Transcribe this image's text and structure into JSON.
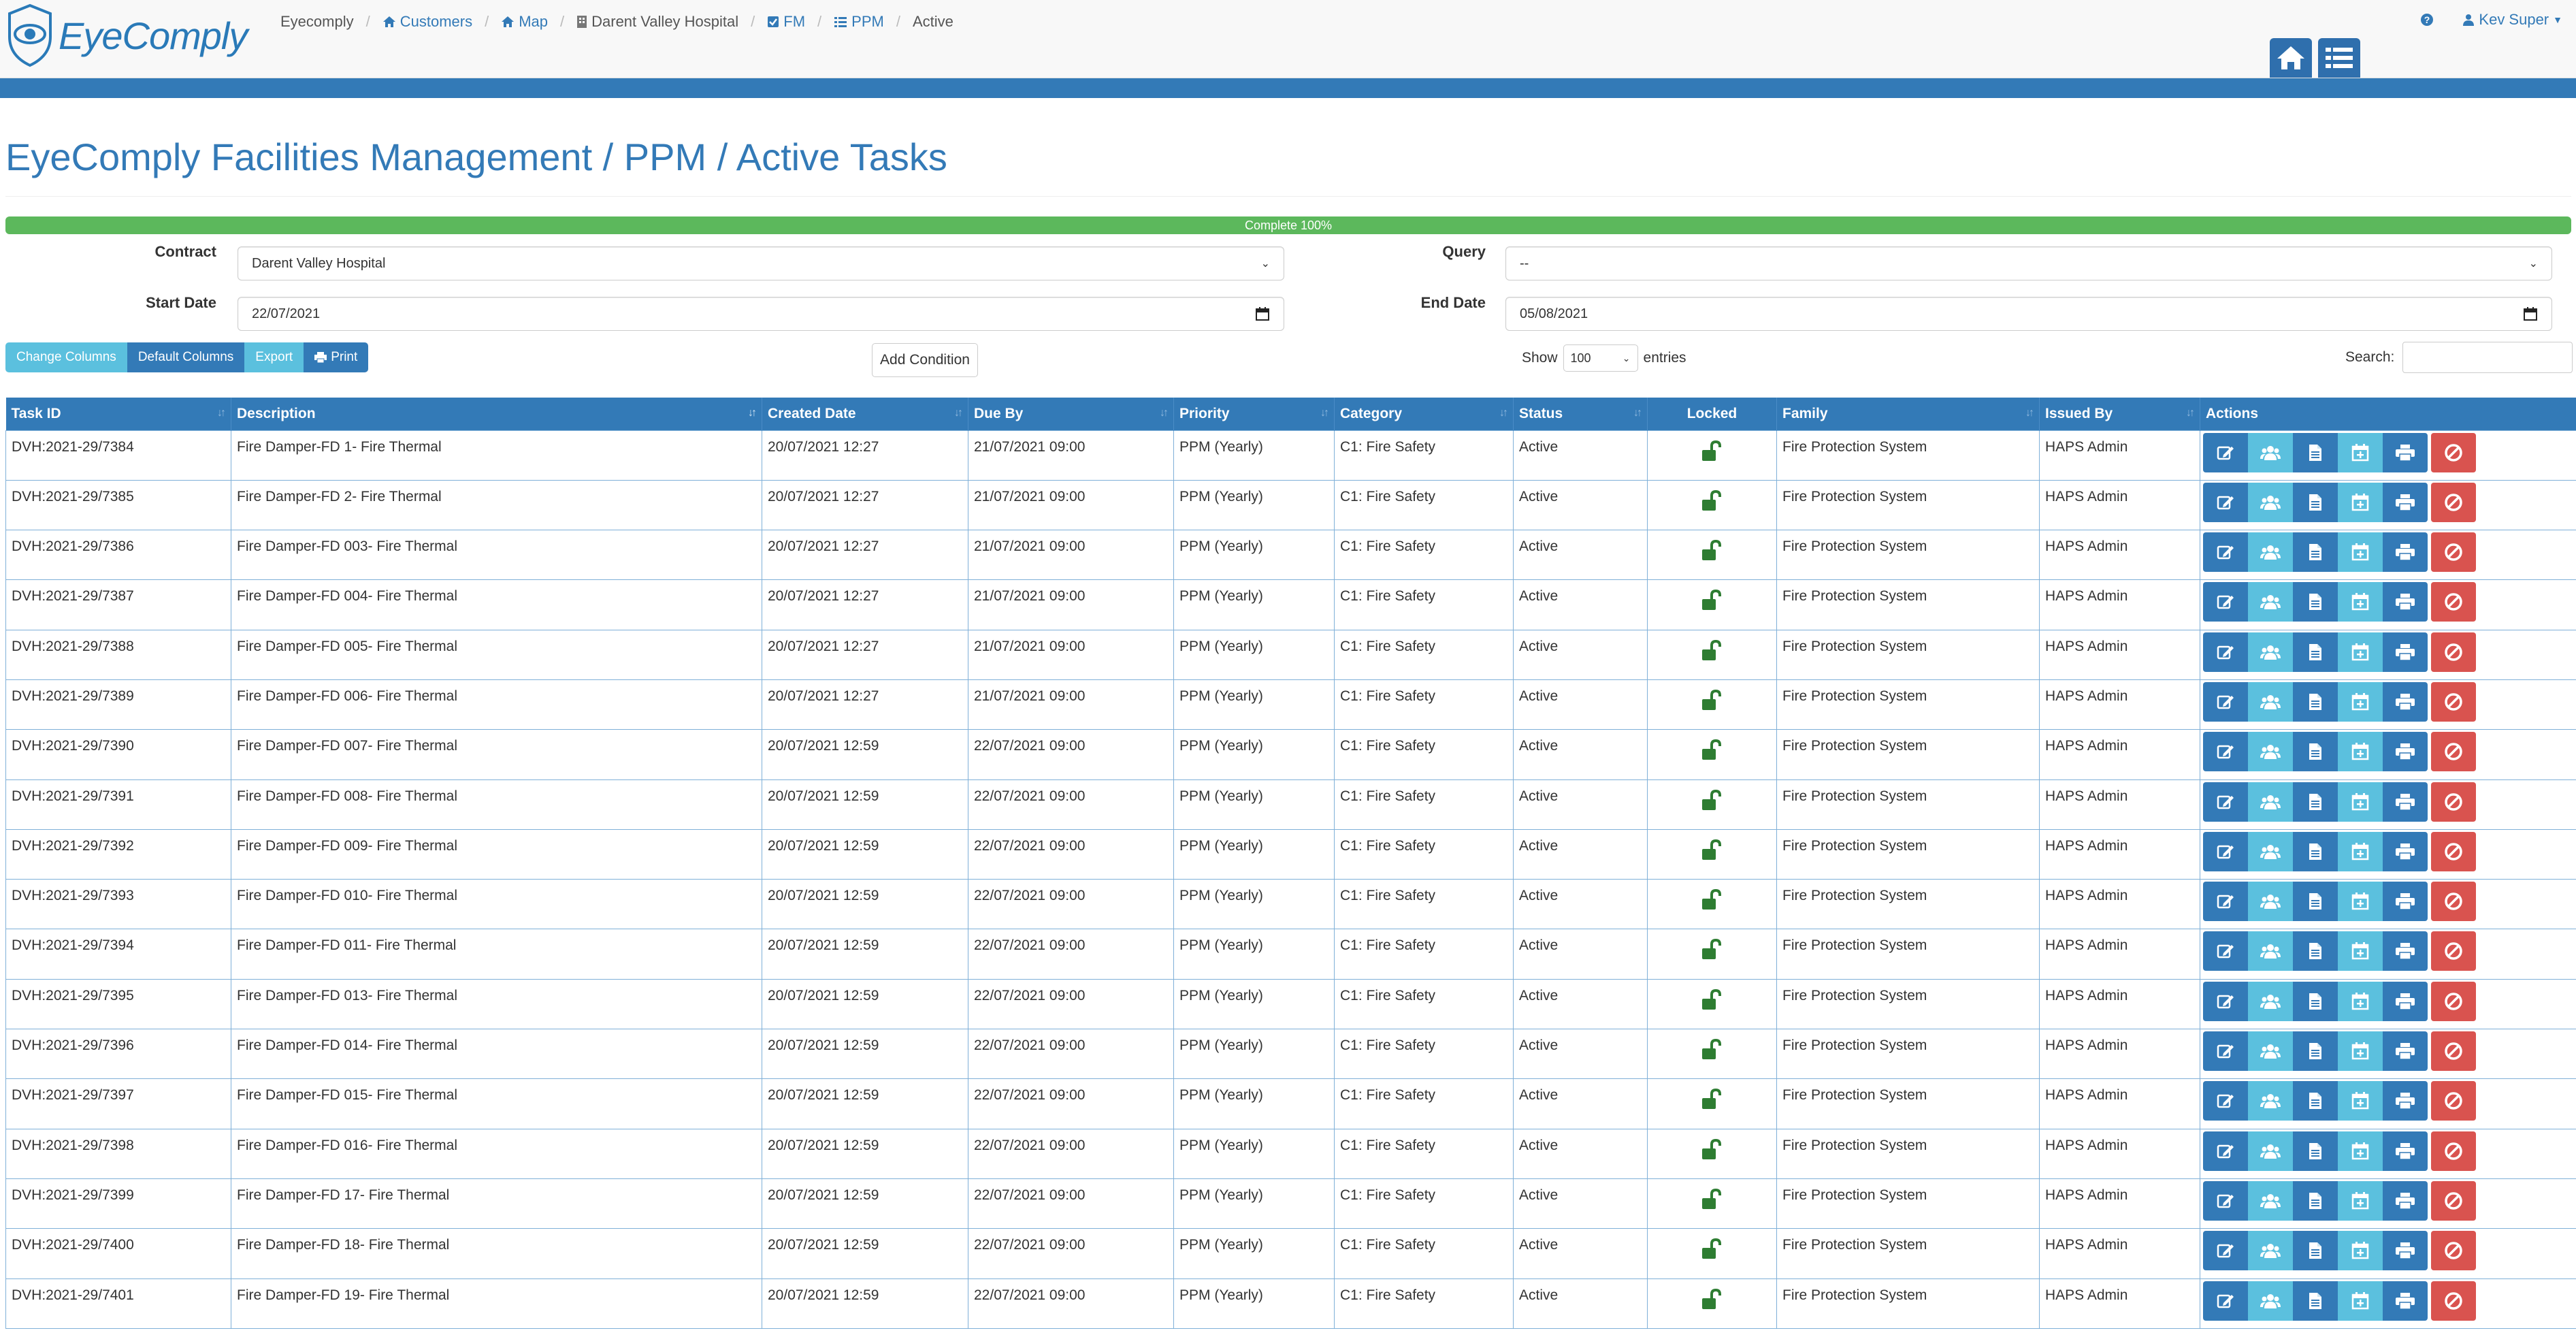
{
  "brand": {
    "name": "EyeComply"
  },
  "breadcrumb": [
    "Eyecomply",
    "Customers",
    "Map",
    "Darent Valley Hospital",
    "FM",
    "PPM",
    "Active"
  ],
  "user": {
    "name": "Kev Super"
  },
  "page": {
    "title": "EyeComply Facilities Management / PPM / Active Tasks"
  },
  "progress": {
    "label": "Complete 100%",
    "value": 1.0
  },
  "form": {
    "contract_label": "Contract",
    "contract_value": "Darent Valley Hospital",
    "query_label": "Query",
    "query_value": "--",
    "start_label": "Start Date",
    "start_value": "22/07/2021",
    "end_label": "End Date",
    "end_value": "05/08/2021"
  },
  "toolbar": {
    "change_columns": "Change Columns",
    "default_columns": "Default Columns",
    "export": "Export",
    "print": "Print",
    "add_condition": "Add Condition"
  },
  "table_controls": {
    "show": "Show",
    "entries_value": "100",
    "entries": "entries",
    "search": "Search:"
  },
  "columns": [
    "Task ID",
    "Description",
    "Created Date",
    "Due By",
    "Priority",
    "Category",
    "Status",
    "Locked",
    "Family",
    "Issued By",
    "Actions"
  ],
  "rows": [
    {
      "id": "DVH:2021-29/7384",
      "desc": "Fire Damper-FD 1- Fire Thermal",
      "created": "20/07/2021 12:27",
      "due": "21/07/2021 09:00",
      "priority": "PPM (Yearly)",
      "category": "C1: Fire Safety",
      "status": "Active",
      "family": "Fire Protection System",
      "issued": "HAPS Admin"
    },
    {
      "id": "DVH:2021-29/7385",
      "desc": "Fire Damper-FD 2- Fire Thermal",
      "created": "20/07/2021 12:27",
      "due": "21/07/2021 09:00",
      "priority": "PPM (Yearly)",
      "category": "C1: Fire Safety",
      "status": "Active",
      "family": "Fire Protection System",
      "issued": "HAPS Admin"
    },
    {
      "id": "DVH:2021-29/7386",
      "desc": "Fire Damper-FD 003- Fire Thermal",
      "created": "20/07/2021 12:27",
      "due": "21/07/2021 09:00",
      "priority": "PPM (Yearly)",
      "category": "C1: Fire Safety",
      "status": "Active",
      "family": "Fire Protection System",
      "issued": "HAPS Admin"
    },
    {
      "id": "DVH:2021-29/7387",
      "desc": "Fire Damper-FD 004- Fire Thermal",
      "created": "20/07/2021 12:27",
      "due": "21/07/2021 09:00",
      "priority": "PPM (Yearly)",
      "category": "C1: Fire Safety",
      "status": "Active",
      "family": "Fire Protection System",
      "issued": "HAPS Admin"
    },
    {
      "id": "DVH:2021-29/7388",
      "desc": "Fire Damper-FD 005- Fire Thermal",
      "created": "20/07/2021 12:27",
      "due": "21/07/2021 09:00",
      "priority": "PPM (Yearly)",
      "category": "C1: Fire Safety",
      "status": "Active",
      "family": "Fire Protection System",
      "issued": "HAPS Admin"
    },
    {
      "id": "DVH:2021-29/7389",
      "desc": "Fire Damper-FD 006- Fire Thermal",
      "created": "20/07/2021 12:27",
      "due": "21/07/2021 09:00",
      "priority": "PPM (Yearly)",
      "category": "C1: Fire Safety",
      "status": "Active",
      "family": "Fire Protection System",
      "issued": "HAPS Admin"
    },
    {
      "id": "DVH:2021-29/7390",
      "desc": "Fire Damper-FD 007- Fire Thermal",
      "created": "20/07/2021 12:59",
      "due": "22/07/2021 09:00",
      "priority": "PPM (Yearly)",
      "category": "C1: Fire Safety",
      "status": "Active",
      "family": "Fire Protection System",
      "issued": "HAPS Admin"
    },
    {
      "id": "DVH:2021-29/7391",
      "desc": "Fire Damper-FD 008- Fire Thermal",
      "created": "20/07/2021 12:59",
      "due": "22/07/2021 09:00",
      "priority": "PPM (Yearly)",
      "category": "C1: Fire Safety",
      "status": "Active",
      "family": "Fire Protection System",
      "issued": "HAPS Admin"
    },
    {
      "id": "DVH:2021-29/7392",
      "desc": "Fire Damper-FD 009- Fire Thermal",
      "created": "20/07/2021 12:59",
      "due": "22/07/2021 09:00",
      "priority": "PPM (Yearly)",
      "category": "C1: Fire Safety",
      "status": "Active",
      "family": "Fire Protection System",
      "issued": "HAPS Admin"
    },
    {
      "id": "DVH:2021-29/7393",
      "desc": "Fire Damper-FD 010- Fire Thermal",
      "created": "20/07/2021 12:59",
      "due": "22/07/2021 09:00",
      "priority": "PPM (Yearly)",
      "category": "C1: Fire Safety",
      "status": "Active",
      "family": "Fire Protection System",
      "issued": "HAPS Admin"
    },
    {
      "id": "DVH:2021-29/7394",
      "desc": "Fire Damper-FD 011- Fire Thermal",
      "created": "20/07/2021 12:59",
      "due": "22/07/2021 09:00",
      "priority": "PPM (Yearly)",
      "category": "C1: Fire Safety",
      "status": "Active",
      "family": "Fire Protection System",
      "issued": "HAPS Admin"
    },
    {
      "id": "DVH:2021-29/7395",
      "desc": "Fire Damper-FD 013- Fire Thermal",
      "created": "20/07/2021 12:59",
      "due": "22/07/2021 09:00",
      "priority": "PPM (Yearly)",
      "category": "C1: Fire Safety",
      "status": "Active",
      "family": "Fire Protection System",
      "issued": "HAPS Admin"
    },
    {
      "id": "DVH:2021-29/7396",
      "desc": "Fire Damper-FD 014- Fire Thermal",
      "created": "20/07/2021 12:59",
      "due": "22/07/2021 09:00",
      "priority": "PPM (Yearly)",
      "category": "C1: Fire Safety",
      "status": "Active",
      "family": "Fire Protection System",
      "issued": "HAPS Admin"
    },
    {
      "id": "DVH:2021-29/7397",
      "desc": "Fire Damper-FD 015- Fire Thermal",
      "created": "20/07/2021 12:59",
      "due": "22/07/2021 09:00",
      "priority": "PPM (Yearly)",
      "category": "C1: Fire Safety",
      "status": "Active",
      "family": "Fire Protection System",
      "issued": "HAPS Admin"
    },
    {
      "id": "DVH:2021-29/7398",
      "desc": "Fire Damper-FD 016- Fire Thermal",
      "created": "20/07/2021 12:59",
      "due": "22/07/2021 09:00",
      "priority": "PPM (Yearly)",
      "category": "C1: Fire Safety",
      "status": "Active",
      "family": "Fire Protection System",
      "issued": "HAPS Admin"
    },
    {
      "id": "DVH:2021-29/7399",
      "desc": "Fire Damper-FD 17- Fire Thermal",
      "created": "20/07/2021 12:59",
      "due": "22/07/2021 09:00",
      "priority": "PPM (Yearly)",
      "category": "C1: Fire Safety",
      "status": "Active",
      "family": "Fire Protection System",
      "issued": "HAPS Admin"
    },
    {
      "id": "DVH:2021-29/7400",
      "desc": "Fire Damper-FD 18- Fire Thermal",
      "created": "20/07/2021 12:59",
      "due": "22/07/2021 09:00",
      "priority": "PPM (Yearly)",
      "category": "C1: Fire Safety",
      "status": "Active",
      "family": "Fire Protection System",
      "issued": "HAPS Admin"
    },
    {
      "id": "DVH:2021-29/7401",
      "desc": "Fire Damper-FD 19- Fire Thermal",
      "created": "20/07/2021 12:59",
      "due": "22/07/2021 09:00",
      "priority": "PPM (Yearly)",
      "category": "C1: Fire Safety",
      "status": "Active",
      "family": "Fire Protection System",
      "issued": "HAPS Admin"
    }
  ],
  "colors": {
    "primary": "#337ab7",
    "info": "#5bc0de",
    "success": "#5cb85c",
    "danger": "#d9534f",
    "lock": "#2e7d32"
  },
  "icons": {
    "home": "home-icon",
    "list": "list-icon",
    "help": "question-circle-icon",
    "user": "user-icon",
    "lock": "unlocked-padlock-icon",
    "actions": [
      "edit-icon",
      "users-icon",
      "document-icon",
      "calendar-plus-icon",
      "print-icon",
      "cancel-icon"
    ]
  }
}
